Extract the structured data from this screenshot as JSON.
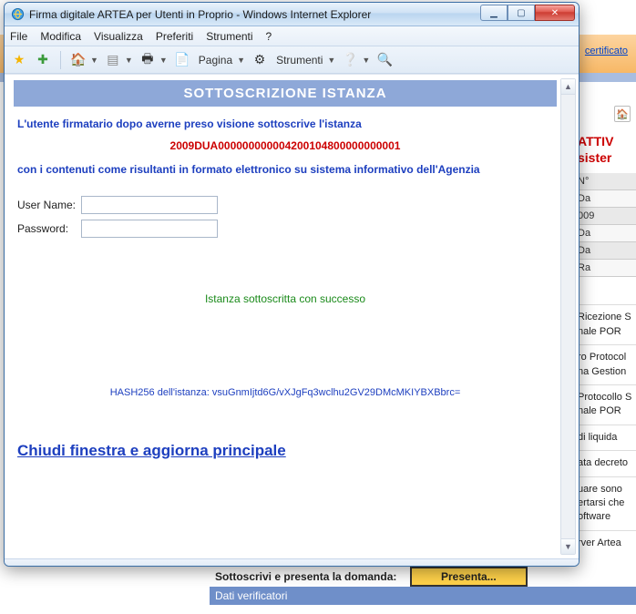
{
  "window": {
    "title": "Firma digitale ARTEA per Utenti in Proprio - Windows Internet Explorer"
  },
  "menu": {
    "file": "File",
    "edit": "Modifica",
    "view": "Visualizza",
    "favorites": "Preferiti",
    "tools": "Strumenti",
    "help": "?"
  },
  "toolbar": {
    "page": "Pagina",
    "tools": "Strumenti"
  },
  "page": {
    "banner": "SOTTOSCRIZIONE ISTANZA",
    "line1": "L'utente firmatario dopo averne preso visione sottoscrive l'istanza",
    "code": "2009DUA000000000004200104800000000001",
    "line2": "con i contenuti come risultanti in formato elettronico su sistema informativo dell'Agenzia",
    "user_label": "User Name:",
    "pass_label": "Password:",
    "user_value": "",
    "pass_value": "",
    "success": "Istanza sottoscritta con successo",
    "hash": "HASH256 dell'istanza: vsuGnmIjtd6G/vXJgFq3wclhu2GV29DMcMKIYBXBbrc=",
    "close_link": "Chiudi finestra e aggiorna principale"
  },
  "background": {
    "cert_link": "certificato",
    "red_header": "ATTIV sister",
    "rows": {
      "n": "N°",
      "da1": "Da",
      "year": "009",
      "da2": "Da",
      "da3": "Da",
      "ra": "Ra"
    },
    "texts": {
      "t1": "Ricezione S nale POR",
      "t2": "ro Protocol na Gestion",
      "t3": "Protocollo S nale POR",
      "t4": "di liquida",
      "t5": "ata decreto",
      "t6": "uare sono ertarsi che oftware",
      "t7": "rver Artea"
    },
    "submit_label": "Sottoscrivi e presenta la domanda:",
    "presenta": "Presenta...",
    "dati": "Dati verificatori"
  }
}
